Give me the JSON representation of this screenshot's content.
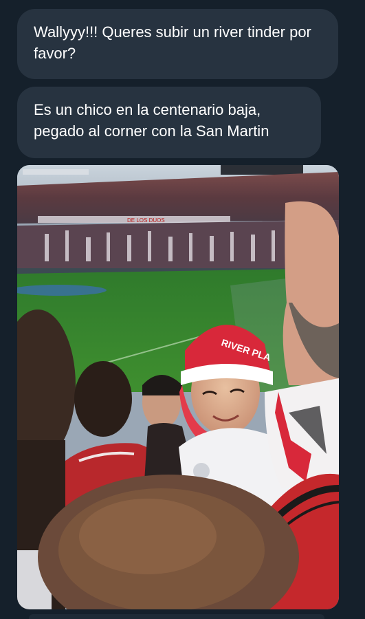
{
  "messages": [
    {
      "text": "Wallyyy!!! Queres subir un river tinder por favor?"
    },
    {
      "text": "Es un chico en la centenario baja, pegado al corner con la San Martin"
    }
  ],
  "photo": {
    "subject": "River Plate fans in a stadium",
    "hat_text": "RIVER PLA"
  },
  "colors": {
    "background": "#15202b",
    "bubble": "#273340",
    "text": "#ffffff"
  }
}
